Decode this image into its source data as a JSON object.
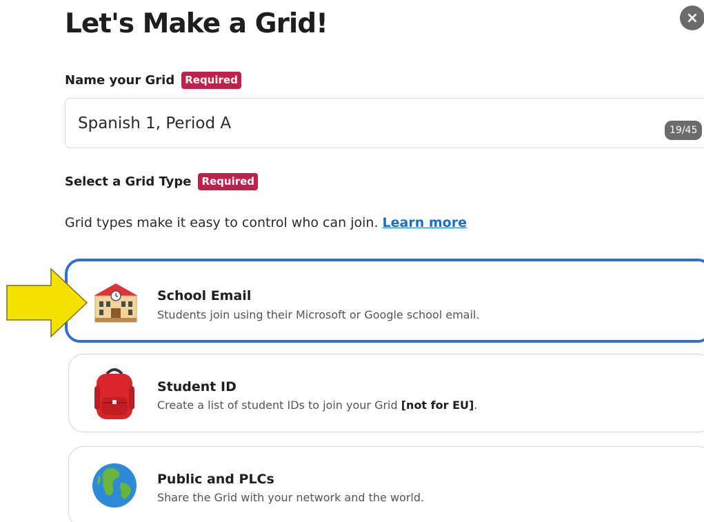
{
  "dialog": {
    "title": "Let's Make a Grid!",
    "close_label": "×"
  },
  "name_field": {
    "label": "Name your Grid",
    "required_label": "Required",
    "value": "Spanish 1, Period A",
    "char_count": "19/45"
  },
  "grid_type": {
    "label": "Select a Grid Type",
    "required_label": "Required",
    "helper_text": "Grid types make it easy to control who can join.",
    "learn_more_label": "Learn more",
    "options": [
      {
        "title": "School Email",
        "description": "Students join using their Microsoft or Google school email.",
        "icon": "school-building-icon",
        "selected": true
      },
      {
        "title": "Student ID",
        "description_prefix": "Create a list of student IDs to join your Grid ",
        "description_bold": "[not for EU]",
        "description_suffix": ".",
        "icon": "backpack-icon",
        "selected": false
      },
      {
        "title": "Public and PLCs",
        "description": "Share the Grid with your network and the world.",
        "icon": "globe-icon",
        "selected": false
      }
    ]
  },
  "annotation": {
    "icon": "yellow-arrow-icon",
    "color": "#f5e100"
  },
  "colors": {
    "required_badge": "#c0214a",
    "selected_border": "#2f6fd4",
    "link": "#1b6fc9"
  }
}
